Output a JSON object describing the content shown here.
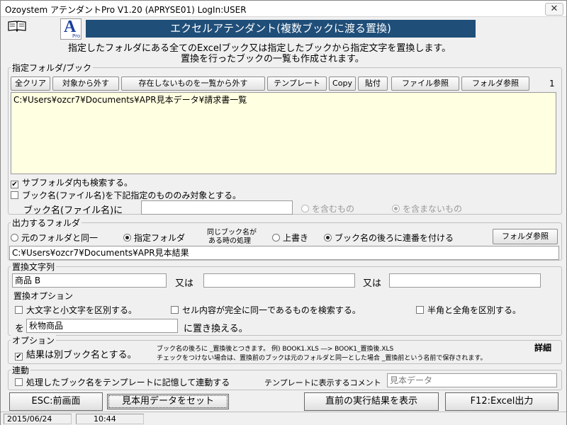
{
  "window": {
    "title": "Ozoystem アテンダントPro V1.20 (APRYSE01)  LogIn:USER",
    "close": "✕"
  },
  "header": {
    "logo_letter": "A",
    "logo_sub": "Pro",
    "banner": "エクセルアテンダント(複数ブックに渡る置換)",
    "desc1": "指定したフォルダにある全てのExcelブック又は指定したブックから指定文字を置換します。",
    "desc2": "置換を行ったブックの一覧も作成されます。"
  },
  "folder_book": {
    "label": "指定フォルダ/ブック",
    "buttons": [
      "全クリア",
      "対象から外す",
      "存在しないものを一覧から外す",
      "テンプレート",
      "Copy",
      "貼付",
      "ファイル参照",
      "フォルダ参照"
    ],
    "count": "1",
    "list_items": [
      "C:¥Users¥ozcr7¥Documents¥APR見本データ¥請求書一覧"
    ],
    "subfolder_label": "サブフォルダ内も検索する。",
    "subfolder_checked": true,
    "bookname_only_label": "ブック名(ファイル名)を下記指定のもののみ対象とする。",
    "bookname_only_checked": false,
    "bookname_label": "ブック名(ファイル名)に",
    "bookname_value": "",
    "contains_label": "を含むもの",
    "not_contains_label": "を含まないもの"
  },
  "output": {
    "label": "出力するフォルダ",
    "same_folder": "元のフォルダと同一",
    "specified_folder": "指定フォルダ",
    "same_name_label_1": "同じブック名が",
    "same_name_label_2": "ある時の処理",
    "overwrite": "上書き",
    "append_serial": "ブック名の後ろに連番を付ける",
    "folder_ref": "フォルダ参照",
    "path": "C:¥Users¥ozcr7¥Documents¥APR見本結果"
  },
  "replace": {
    "label": "置換文字列",
    "term1": "商品 B",
    "term2": "",
    "term3": "",
    "or_label": "又は",
    "options_label": "置換オプション",
    "opt_case": "大文字と小文字を区別する。",
    "opt_whole": "セル内容が完全に同一であるものを検索する。",
    "opt_width": "半角と全角を区別する。",
    "with_prefix": "を",
    "with_value": "秋物商品",
    "with_suffix": "に置き換える。"
  },
  "option": {
    "label": "オプション",
    "separate_book": "結果は別ブック名とする。",
    "separate_checked": true,
    "note1": "ブック名の後ろに _置換後とつきます。 例) BOOK1.XLS ―> BOOK1_置換後.XLS",
    "note2": "チェックをつけない場合は、置換前のブックは元のフォルダと同一とした場合 _置換前という名前で保存されます。",
    "detail": "詳細"
  },
  "link": {
    "label": "連動",
    "record_label": "処理したブック名をテンプレートに記憶して連動する",
    "comment_label": "テンプレートに表示するコメント",
    "comment_value": "見本データ"
  },
  "footer": {
    "esc": "ESC:前画面",
    "sample": "見本用データをセット",
    "prev_result": "直前の実行結果を表示",
    "f12": "F12:Excel出力"
  },
  "status": {
    "date": "2015/06/24",
    "time": "10:44"
  },
  "colors": {
    "banner": "#1f4e79",
    "list_bg": "#ffffe1"
  }
}
